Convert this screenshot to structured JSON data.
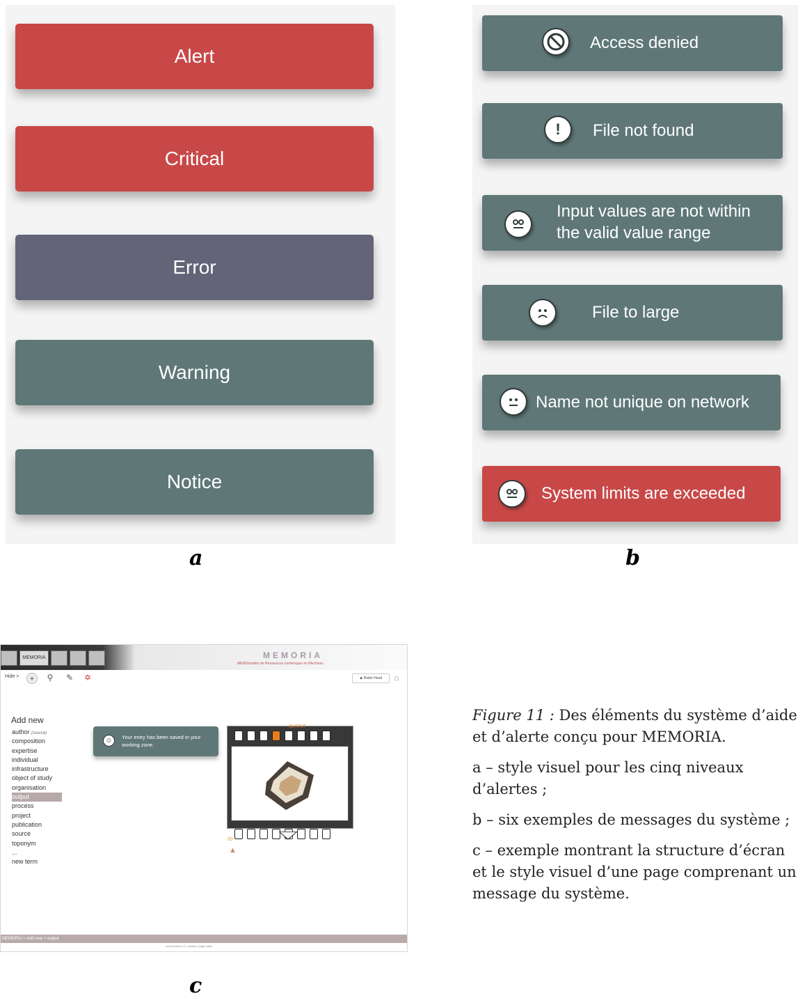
{
  "panel_a": {
    "levels": [
      {
        "label": "Alert",
        "color": "#c84848"
      },
      {
        "label": "Critical",
        "color": "#c84848"
      },
      {
        "label": "Error",
        "color": "#646478"
      },
      {
        "label": "Warning",
        "color": "#5f7777"
      },
      {
        "label": "Notice",
        "color": "#5f7777"
      }
    ],
    "caption": "a"
  },
  "panel_b": {
    "messages": [
      {
        "label": "Access denied",
        "icon": "no-entry-icon",
        "color": "#5f7777"
      },
      {
        "label": "File not found",
        "icon": "exclamation-icon",
        "color": "#5f7777"
      },
      {
        "line1": "Input values are not within",
        "line2": "the valid value range",
        "icon": "dizzy-face-icon",
        "color": "#5f7777"
      },
      {
        "label": "File to large",
        "icon": "sad-face-icon",
        "color": "#5f7777"
      },
      {
        "label": "Name not unique on network",
        "icon": "neutral-face-icon",
        "color": "#5f7777"
      },
      {
        "label": "System limits are exceeded",
        "icon": "dizzy-face-icon",
        "color": "#c84848"
      }
    ],
    "caption": "b"
  },
  "panel_c": {
    "brand": "MEMORIA",
    "brand_sub": "MEMOrisation de Ressources numériques et d'Archives",
    "logo_text": "MEMORIA",
    "toolbar": {
      "hide": "Hide >",
      "user": "Robin Hood"
    },
    "sidebar": {
      "title": "Add new",
      "items": [
        "author",
        "composition",
        "expertise",
        "individual",
        "infrastructure",
        "object of study",
        "organisation",
        "output",
        "process",
        "project",
        "publication",
        "source",
        "toponym",
        "...",
        "new term"
      ],
      "author_note": "(source)",
      "selected": "output"
    },
    "message": {
      "text": "Your entry has been saved in your working zone.",
      "icon": "smiley-icon"
    },
    "frame_tag": "OUTPUT",
    "frame_counter": "00",
    "statusbar": "MEMORIA > Add new > output",
    "footer": "version beta 0.4   |   contact   |   legal notes",
    "caption": "c"
  },
  "figure_caption": {
    "label": "Figure 11 :",
    "title_rest": " Des éléments du système d’aide",
    "title_line2": "et d’alerte conçu pour MEMORIA.",
    "a_line1": "a  –  style  visuel  pour  les  cinq  niveaux",
    "a_line2": "d’alertes ;",
    "b": "b –  six exemples de messages du système ;",
    "c_line1": "c – exemple montrant la structure d’écran",
    "c_line2": "et le style visuel d’une page comprenant un",
    "c_line3": "message du système."
  }
}
